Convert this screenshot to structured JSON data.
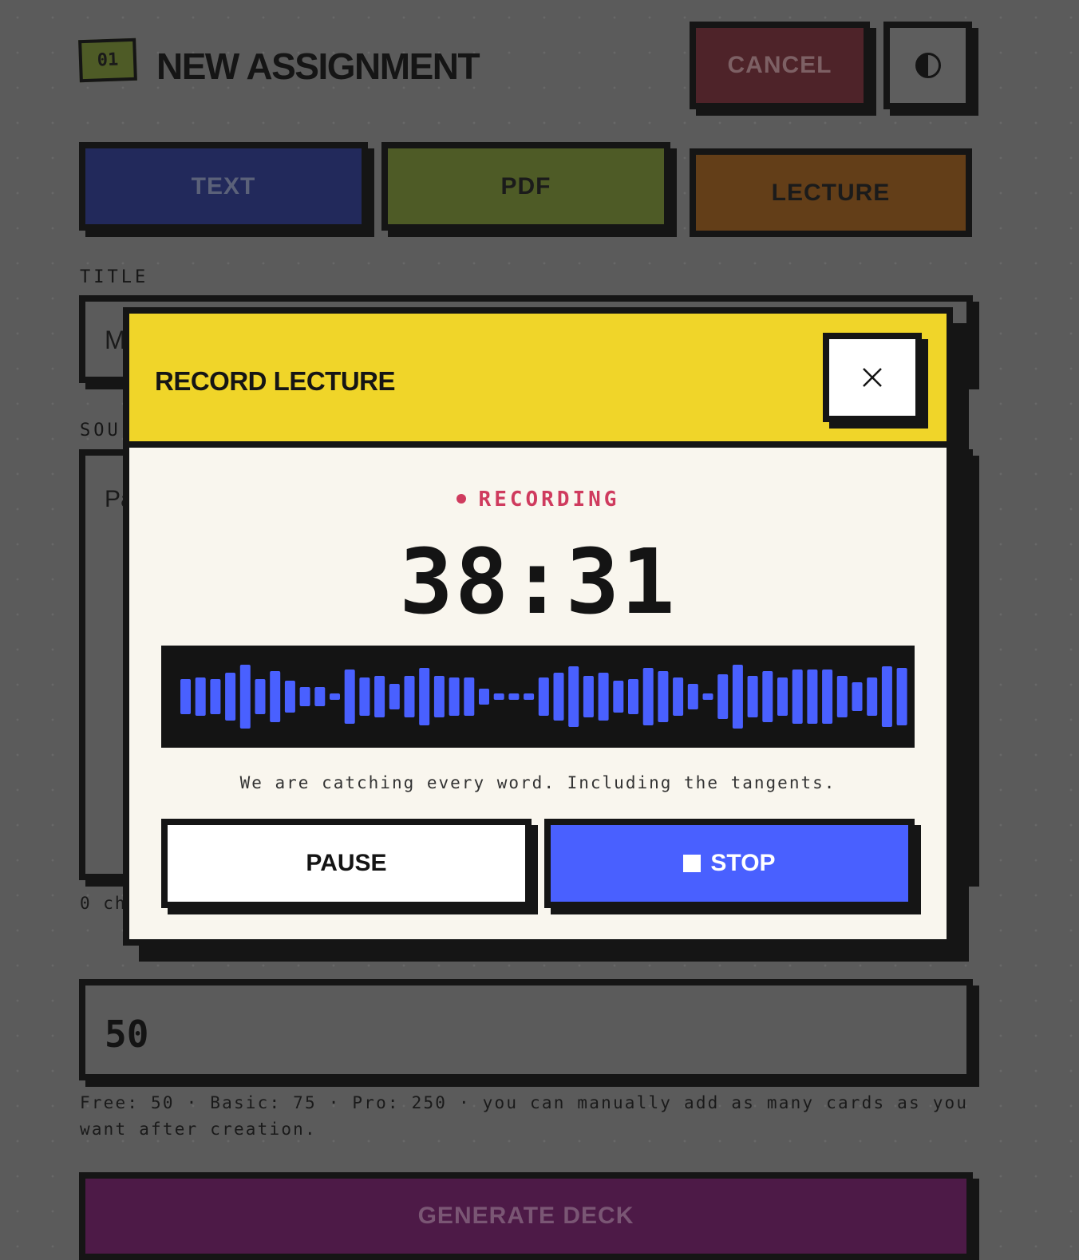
{
  "header": {
    "step_number": "01",
    "title": "NEW ASSIGNMENT",
    "cancel_label": "CANCEL",
    "theme_toggle_icon": "contrast-icon"
  },
  "source_types": [
    {
      "label": "TEXT",
      "color": "#22295b"
    },
    {
      "label": "PDF",
      "color": "#4e5b26"
    },
    {
      "label": "LECTURE",
      "color": "#633e18"
    }
  ],
  "form": {
    "title_label": "TITLE",
    "title_value_visible": "M",
    "source_label_visible": "SOU",
    "source_placeholder_visible": "Pa",
    "char_count_visible": "0 ch",
    "count_value": "50",
    "count_help": "Free: 50 · Basic: 75 · Pro: 250 · you can manually add as many cards as you want after creation.",
    "generate_label": "GENERATE DECK"
  },
  "modal": {
    "title": "RECORD LECTURE",
    "close_icon": "close-icon",
    "status": "RECORDING",
    "timer": "38:31",
    "caption": "We are catching every word. Including the tangents.",
    "pause_label": "PAUSE",
    "stop_label": "STOP",
    "waveform_levels": [
      0.55,
      0.6,
      0.55,
      0.75,
      1.0,
      0.55,
      0.8,
      0.5,
      0.3,
      0.3,
      0.1,
      0.85,
      0.6,
      0.65,
      0.4,
      0.65,
      0.9,
      0.65,
      0.6,
      0.6,
      0.25,
      0.1,
      0.1,
      0.1,
      0.6,
      0.75,
      0.95,
      0.65,
      0.75,
      0.5,
      0.55,
      0.9,
      0.8,
      0.6,
      0.4,
      0.1,
      0.7,
      1.0,
      0.65,
      0.8,
      0.6,
      0.85,
      0.85,
      0.85,
      0.65,
      0.45,
      0.6,
      0.95,
      0.9
    ],
    "colors": {
      "accent": "#f0d529",
      "record": "#cf3b5e",
      "stop": "#4960ff",
      "wave": "#4960ff"
    }
  }
}
